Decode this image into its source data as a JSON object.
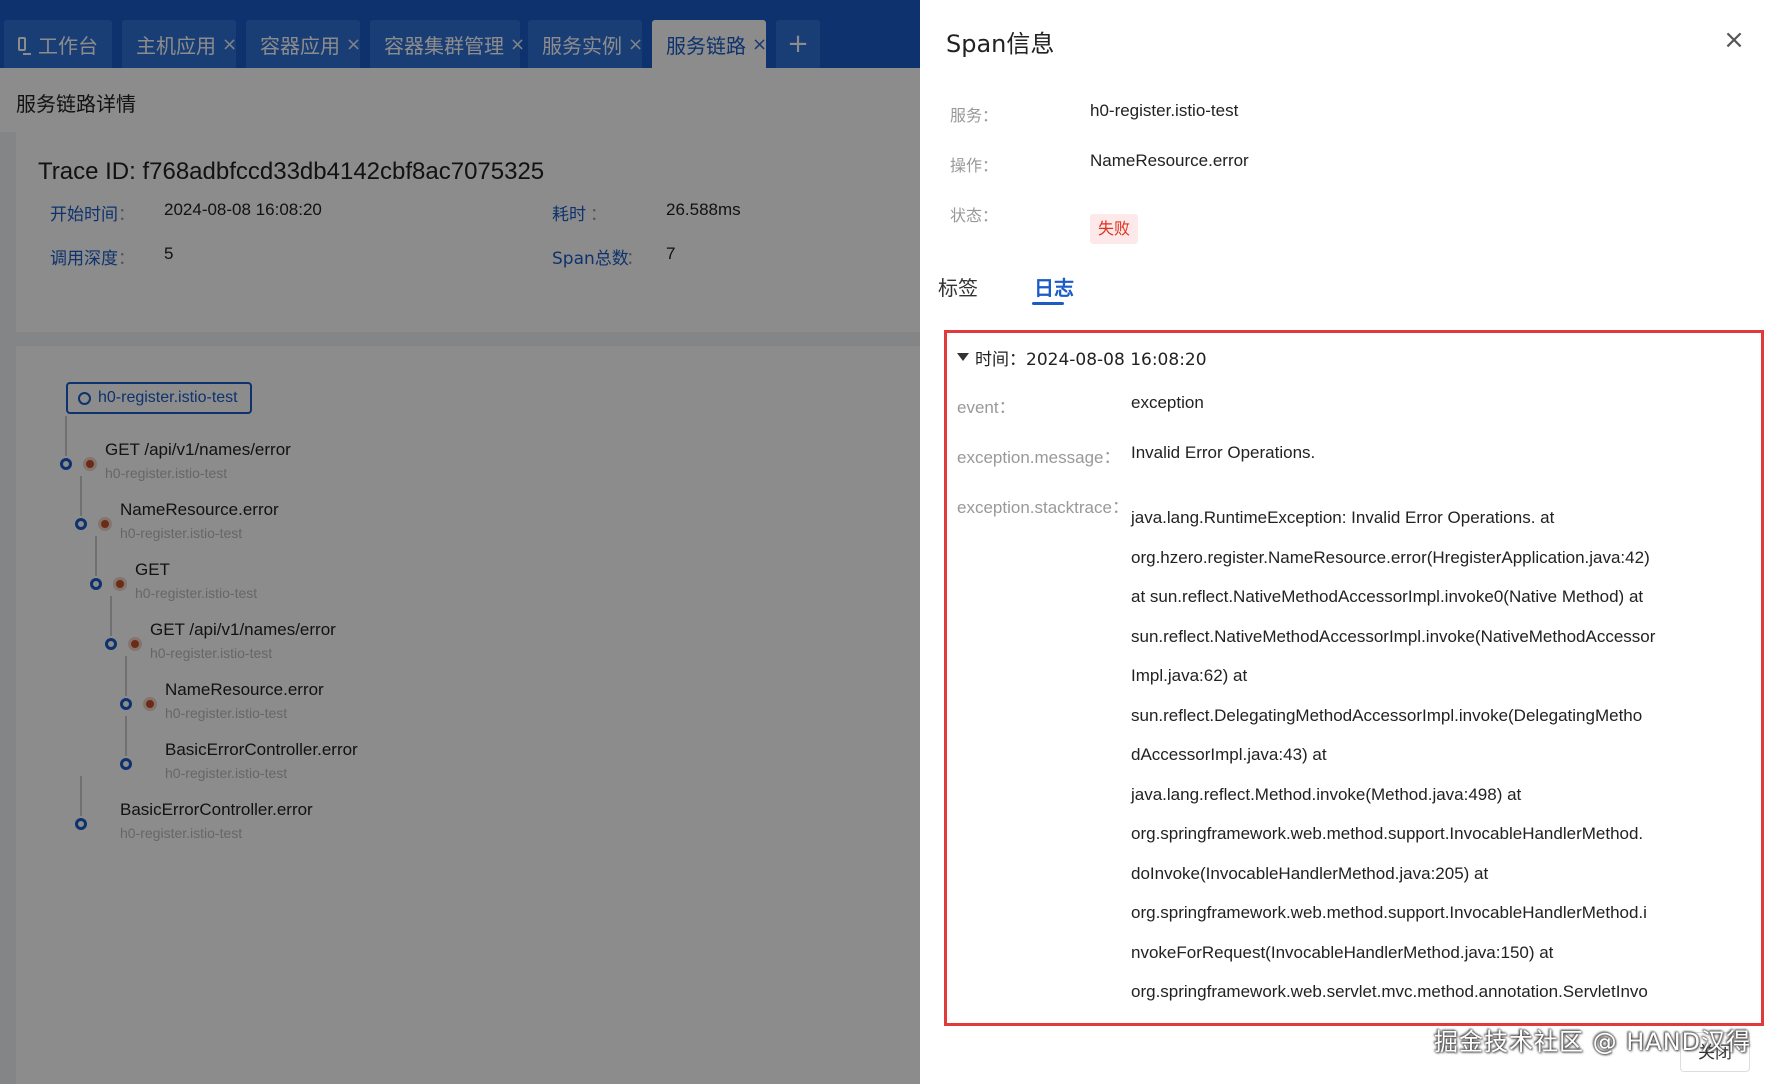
{
  "tabs": [
    {
      "label": "工作台",
      "closable": false,
      "active": false,
      "icon": "monitor-icon"
    },
    {
      "label": "主机应用",
      "closable": true,
      "active": false
    },
    {
      "label": "容器应用",
      "closable": true,
      "active": false
    },
    {
      "label": "容器集群管理",
      "closable": true,
      "active": false
    },
    {
      "label": "服务实例",
      "closable": true,
      "active": false
    },
    {
      "label": "服务链路",
      "closable": true,
      "active": true
    }
  ],
  "tab_close_glyph": "×",
  "tab_add_glyph": "+",
  "page_title": "服务链路详情",
  "summary": {
    "trace_id": "Trace ID: f768adbfccd33db4142cbf8ac7075325",
    "start_label": "开始时间",
    "start_value": "2024-08-08 16:08:20",
    "duration_label": "耗时",
    "duration_value": "26.588ms",
    "depth_label": "调用深度",
    "depth_value": "5",
    "span_count_label": "Span总数",
    "span_count_value": "7",
    "colon": "："
  },
  "tree": {
    "service_pill": "h0-register.istio-test",
    "spans": [
      {
        "operation": "GET /api/v1/names/error",
        "service": "h0-register.istio-test",
        "depth": 0,
        "error": true
      },
      {
        "operation": "NameResource.error",
        "service": "h0-register.istio-test",
        "depth": 1,
        "error": true
      },
      {
        "operation": "GET",
        "service": "h0-register.istio-test",
        "depth": 2,
        "error": true
      },
      {
        "operation": "GET /api/v1/names/error",
        "service": "h0-register.istio-test",
        "depth": 3,
        "error": true
      },
      {
        "operation": "NameResource.error",
        "service": "h0-register.istio-test",
        "depth": 4,
        "error": true
      },
      {
        "operation": "BasicErrorController.error",
        "service": "h0-register.istio-test",
        "depth": 4,
        "error": false
      },
      {
        "operation": "BasicErrorController.error",
        "service": "h0-register.istio-test",
        "depth": 1,
        "error": false
      }
    ]
  },
  "drawer": {
    "title": "Span信息",
    "close_glyph": "×",
    "service_label": "服务：",
    "service_value": "h0-register.istio-test",
    "operation_label": "操作：",
    "operation_value": "NameResource.error",
    "status_label": "状态：",
    "status_value": "失败",
    "tabs": [
      "标签",
      "日志"
    ],
    "active_tab": "日志",
    "log": {
      "time": "时间：2024-08-08 16:08:20",
      "event_key": "event：",
      "event_value": "exception",
      "message_key": "exception.message：",
      "message_value": "Invalid Error Operations.",
      "stacktrace_key": "exception.stacktrace：",
      "stacktrace_lines": [
        "java.lang.RuntimeException: Invalid Error Operations. at",
        "org.hzero.register.NameResource.error(HregisterApplication.java:42)",
        "at sun.reflect.NativeMethodAccessorImpl.invoke0(Native Method) at",
        "sun.reflect.NativeMethodAccessorImpl.invoke(NativeMethodAccessor",
        "Impl.java:62) at",
        "sun.reflect.DelegatingMethodAccessorImpl.invoke(DelegatingMetho",
        "dAccessorImpl.java:43) at",
        "java.lang.reflect.Method.invoke(Method.java:498) at",
        "org.springframework.web.method.support.InvocableHandlerMethod.",
        "doInvoke(InvocableHandlerMethod.java:205) at",
        "org.springframework.web.method.support.InvocableHandlerMethod.i",
        "nvokeForRequest(InvocableHandlerMethod.java:150) at",
        "org.springframework.web.servlet.mvc.method.annotation.ServletInvo"
      ]
    },
    "close_button": "关闭"
  },
  "watermark": "掘金技术社区 @ HAND汉得",
  "colors": {
    "primary": "#1a5bc6",
    "error": "#e0301e",
    "highlight_border": "#e03a3a"
  }
}
